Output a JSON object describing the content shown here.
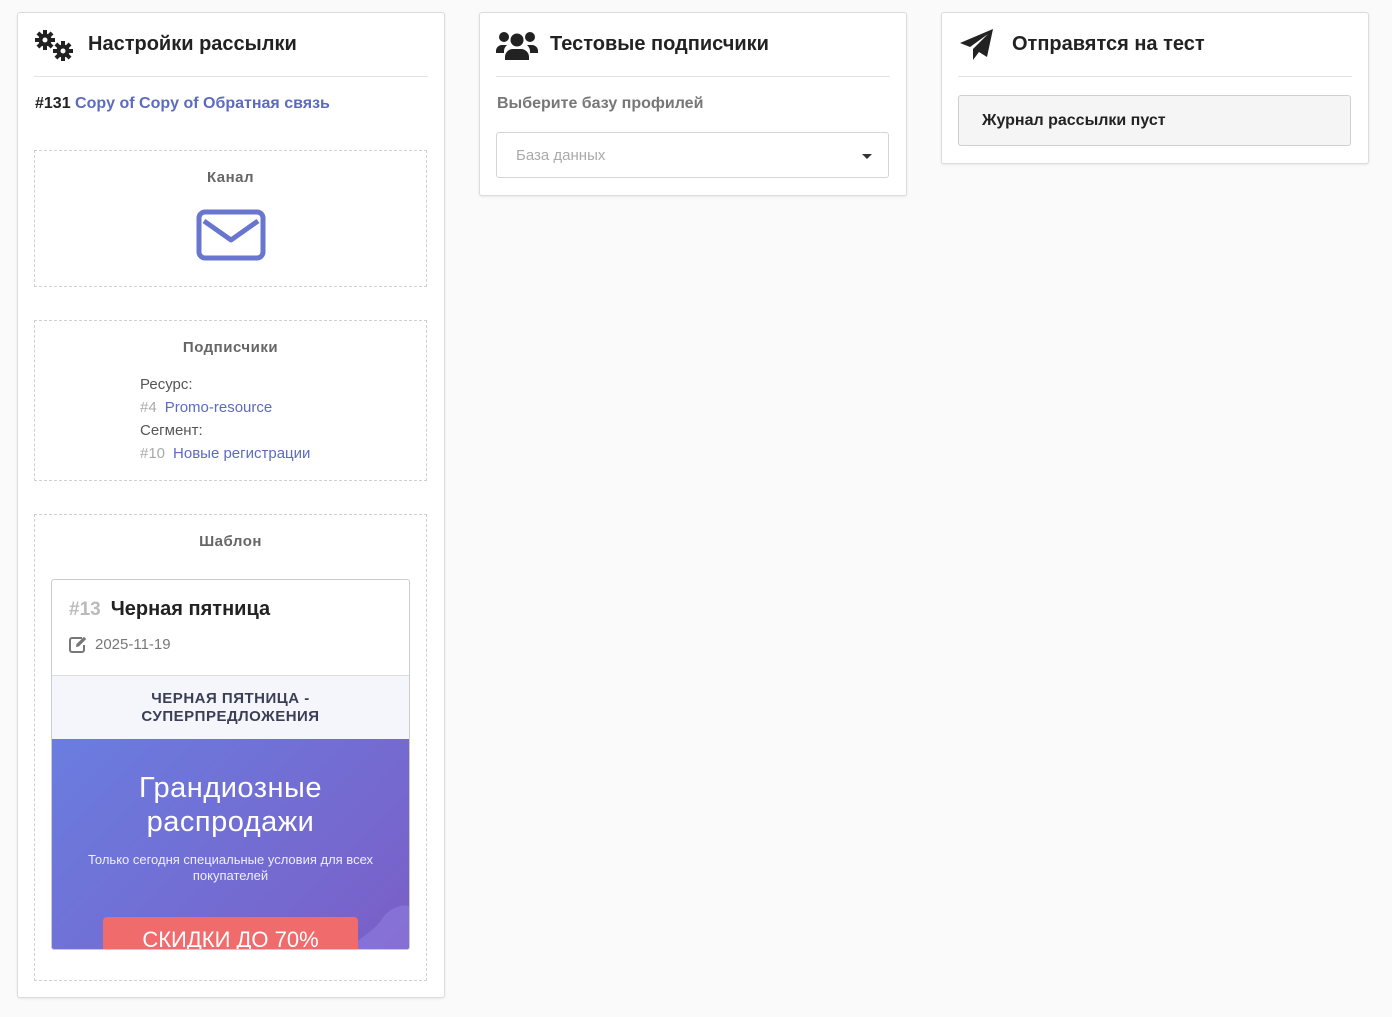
{
  "settings": {
    "title": "Настройки рассылки",
    "mailing_number": "#131",
    "mailing_name": "Copy of Copy of Обратная связь",
    "channel": {
      "title": "Канал",
      "icon": "envelope-icon"
    },
    "subscribers": {
      "title": "Подписчики",
      "resource_label": "Ресурс:",
      "resource_number": "#4",
      "resource_name": "Promo-resource",
      "segment_label": "Сегмент:",
      "segment_number": "#10",
      "segment_name": "Новые регистрации"
    },
    "template": {
      "title": "Шаблон",
      "number": "#13",
      "name": "Черная пятница",
      "date": "2025-11-19",
      "preview": {
        "banner_line1": "ЧЕРНАЯ ПЯТНИЦА -",
        "banner_line2": "СУПЕРПРЕДЛОЖЕНИЯ",
        "hero_line1": "Грандиозные",
        "hero_line2": "распродажи",
        "hero_subtitle": "Только сегодня специальные условия для всех покупателей",
        "cta": "СКИДКИ ДО 70%"
      }
    }
  },
  "test_subscribers": {
    "title": "Тестовые подписчики",
    "select_label": "Выберите базу профилей",
    "select_placeholder": "База данных"
  },
  "send_test": {
    "title": "Отправятся на тест",
    "log_text": "Журнал рассылки пуст"
  },
  "colors": {
    "accent": "#5c6bc0",
    "icon": "#6976cf",
    "cta": "#f06b6b"
  }
}
